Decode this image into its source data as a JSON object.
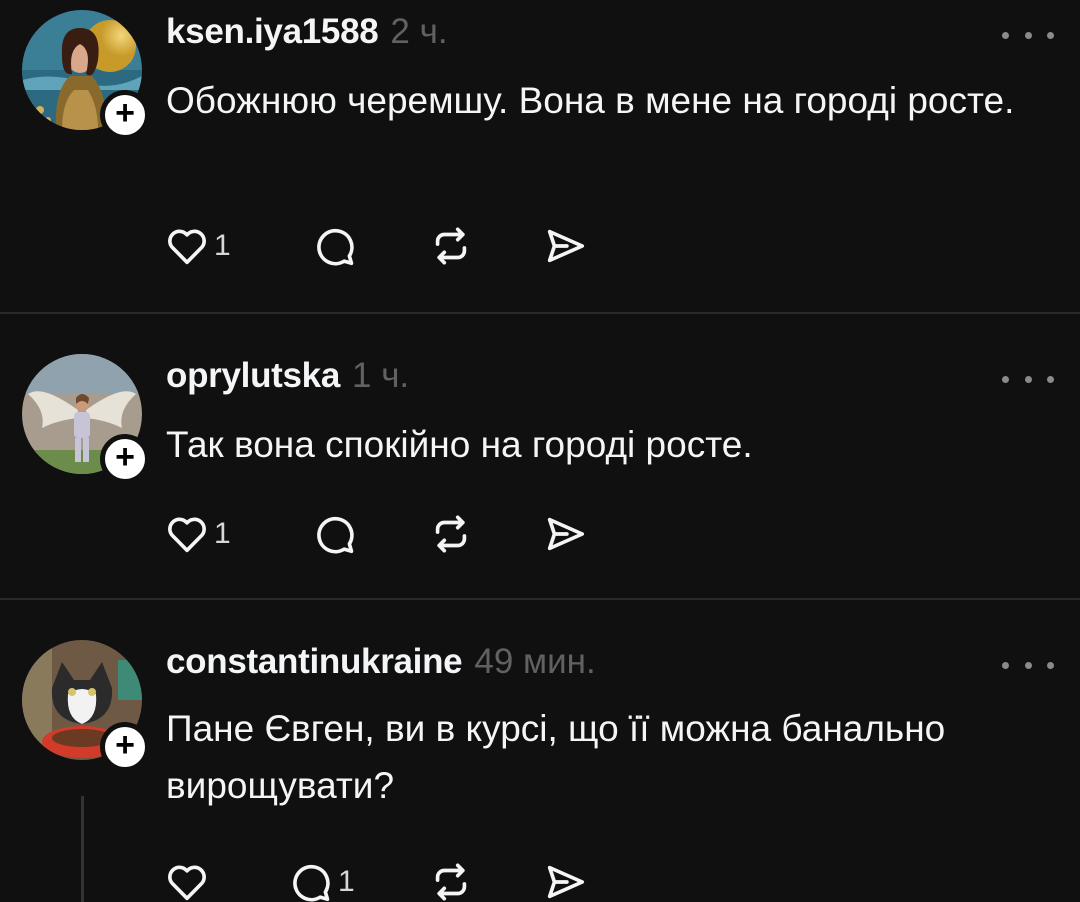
{
  "posts": [
    {
      "username": "ksen.iya1588",
      "time": "2 ч.",
      "text": "Обожнюю черемшу. Вона в мене на городі росте.",
      "likes": "1",
      "replies": "",
      "avatar_icon": "avatar-painted-woman",
      "follow_label": "+"
    },
    {
      "username": "oprylutska",
      "time": "1 ч.",
      "text": "Так вона спокійно на городі росте.",
      "likes": "1",
      "replies": "",
      "avatar_icon": "avatar-woman-angel-wings",
      "follow_label": "+"
    },
    {
      "username": "constantinukraine",
      "time": "49 мин.",
      "text": "Пане Євген, ви в курсі, що її можна банально вирощувати?",
      "likes": "",
      "replies": "1",
      "avatar_icon": "avatar-cat",
      "follow_label": "+"
    }
  ],
  "icons": {
    "like": "heart-icon",
    "reply": "comment-icon",
    "repost": "repost-icon",
    "share": "send-icon",
    "more": "more-icon"
  },
  "colors": {
    "background": "#101010",
    "text": "#f3f5f7",
    "secondary": "#616161",
    "divider": "#2a2a2a"
  }
}
